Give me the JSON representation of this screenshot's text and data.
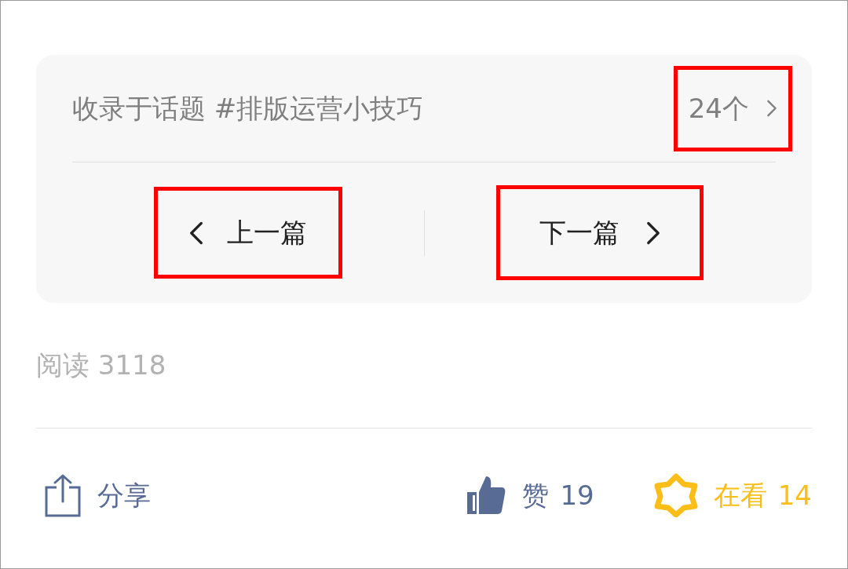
{
  "topic": {
    "text": "收录于话题 #排版运营小技巧",
    "count": "24个",
    "highlighted": true
  },
  "navigation": {
    "previous": {
      "label": "上一篇",
      "highlighted": true
    },
    "next": {
      "label": "下一篇",
      "highlighted": true
    }
  },
  "reads": "阅读 3118",
  "actions": [
    {
      "kind": "share",
      "label": "分享"
    },
    {
      "kind": "like",
      "label": "赞",
      "count": "19"
    },
    {
      "kind": "wow",
      "label": "在看",
      "count": "14"
    }
  ]
}
